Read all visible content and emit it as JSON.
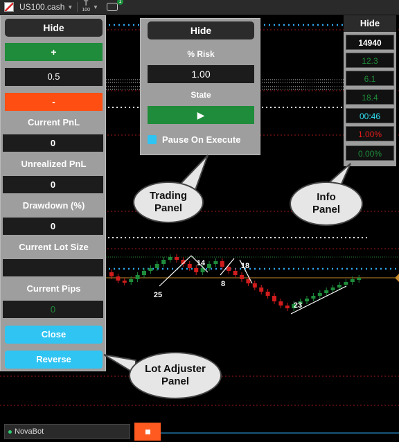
{
  "toolbar": {
    "symbol": "US100.cash",
    "timeframe_prefix": "T",
    "timeframe_value": "100",
    "link_badge": "1"
  },
  "lot_panel": {
    "hide_label": "Hide",
    "plus_label": "+",
    "lot_value": "0.5",
    "minus_label": "-",
    "current_pnl_label": "Current PnL",
    "current_pnl_value": "0",
    "unrealized_pnl_label": "Unrealized PnL",
    "unrealized_pnl_value": "0",
    "drawdown_label": "Drawdown (%)",
    "drawdown_value": "0",
    "lot_size_label": "Current Lot Size",
    "lot_size_value": "",
    "pips_label": "Current Pips",
    "pips_value": "0",
    "close_label": "Close",
    "reverse_label": "Reverse"
  },
  "trading_panel": {
    "hide_label": "Hide",
    "risk_label": "% Risk",
    "risk_value": "1.00",
    "state_label": "State",
    "play_glyph": "▶",
    "pause_label": "Pause On Execute"
  },
  "info_panel": {
    "hide_label": "Hide",
    "values": [
      "14940",
      "12.3",
      "6.1",
      "18.4",
      "00:46",
      "1.00%",
      "0.00%"
    ]
  },
  "callouts": {
    "trading": "Trading\nPanel",
    "info": "Info\nPanel",
    "lot": "Lot Adjuster\nPanel"
  },
  "chart_labels": [
    "25",
    "14",
    "8",
    "18",
    "23"
  ],
  "bottom": {
    "bot_name": "NovaBot"
  },
  "colors": {
    "green": "#1e8c3a",
    "orange": "#ff4e12",
    "cyan": "#2fc4f2",
    "panel": "#9e9e9e"
  }
}
